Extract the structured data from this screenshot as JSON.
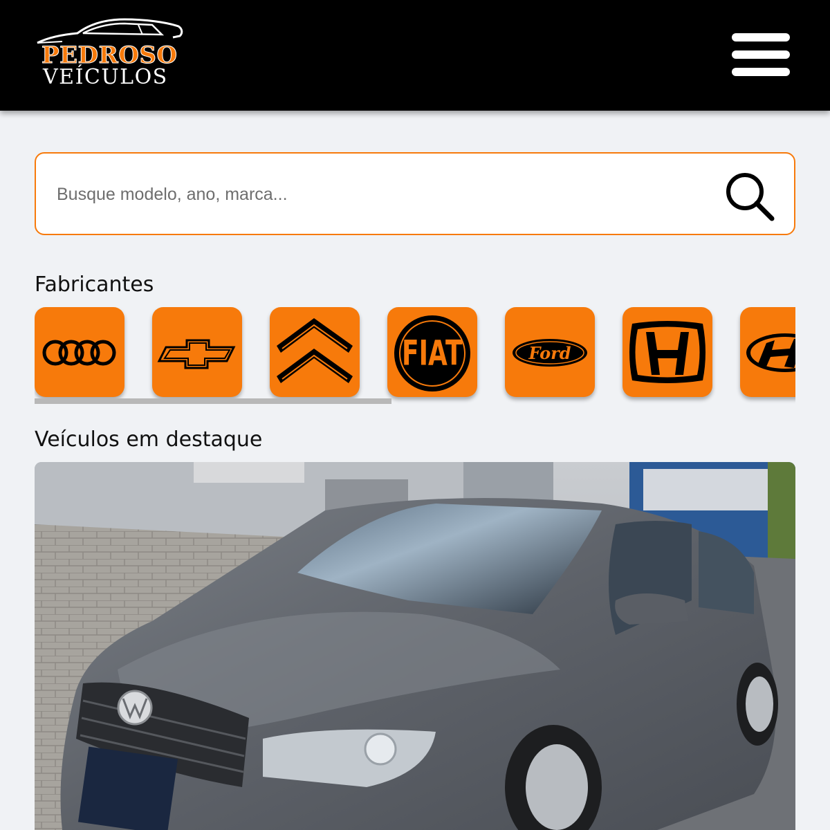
{
  "header": {
    "logo": {
      "line1": "PEDROSO",
      "line2": "VEÍCULOS",
      "icon": "car-silhouette-icon"
    },
    "menu_icon": "hamburger-menu-icon"
  },
  "search": {
    "placeholder": "Busque modelo, ano, marca...",
    "value": "",
    "icon": "search-icon"
  },
  "manufacturers": {
    "title": "Fabricantes",
    "items": [
      {
        "name": "Audi",
        "icon": "audi-logo-icon"
      },
      {
        "name": "Chevrolet",
        "icon": "chevrolet-logo-icon"
      },
      {
        "name": "Citroën",
        "icon": "citroen-logo-icon"
      },
      {
        "name": "Fiat",
        "icon": "fiat-logo-icon",
        "logo_text": "FIAT"
      },
      {
        "name": "Ford",
        "icon": "ford-logo-icon",
        "logo_text": "Ford"
      },
      {
        "name": "Honda",
        "icon": "honda-logo-icon"
      },
      {
        "name": "Hyundai",
        "icon": "hyundai-logo-icon"
      }
    ]
  },
  "featured": {
    "title": "Veículos em destaque",
    "vehicle_image": "gray-sedan-photo"
  },
  "colors": {
    "accent": "#f77a0b",
    "header_bg": "#000000",
    "page_bg": "#f0f2f5"
  }
}
